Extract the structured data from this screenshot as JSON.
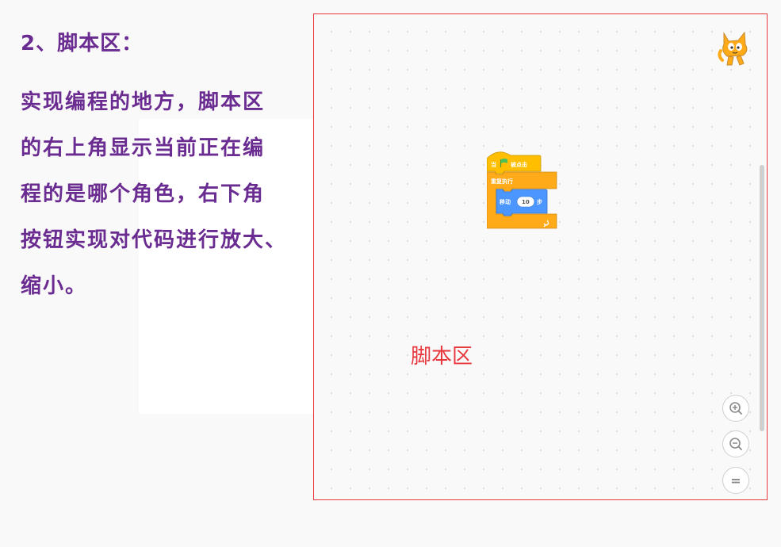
{
  "slide": {
    "title": "2、脚本区：",
    "description_lines": [
      "实现编程的地方，脚本区",
      "的右上角显示当前正在编",
      "程的是哪个角色，右下角",
      "按钮实现对代码进行放大、",
      "缩小。"
    ]
  },
  "workspace": {
    "label": "脚本区",
    "border_color": "#e8383d",
    "sprite_icon": "scratch-cat-icon",
    "zoom_controls": [
      {
        "name": "zoom-in-button",
        "icon": "zoom-in-icon"
      },
      {
        "name": "zoom-out-button",
        "icon": "zoom-out-icon"
      },
      {
        "name": "zoom-reset-button",
        "icon": "equals-icon",
        "glyph": "="
      }
    ],
    "blocks": {
      "hat": {
        "prefix": "当",
        "flag_icon": "green-flag-icon",
        "label": "被点击"
      },
      "loop": {
        "label": "重复执行"
      },
      "motion": {
        "label": "移动",
        "value": "10",
        "suffix": "步"
      },
      "loop_arrow_icon": "loop-arrow-icon"
    }
  },
  "colors": {
    "text_purple": "#6b2c91",
    "accent_red": "#e8383d",
    "events_yellow": "#ffbf00",
    "control_orange": "#ffab19",
    "motion_blue": "#4c97ff"
  }
}
